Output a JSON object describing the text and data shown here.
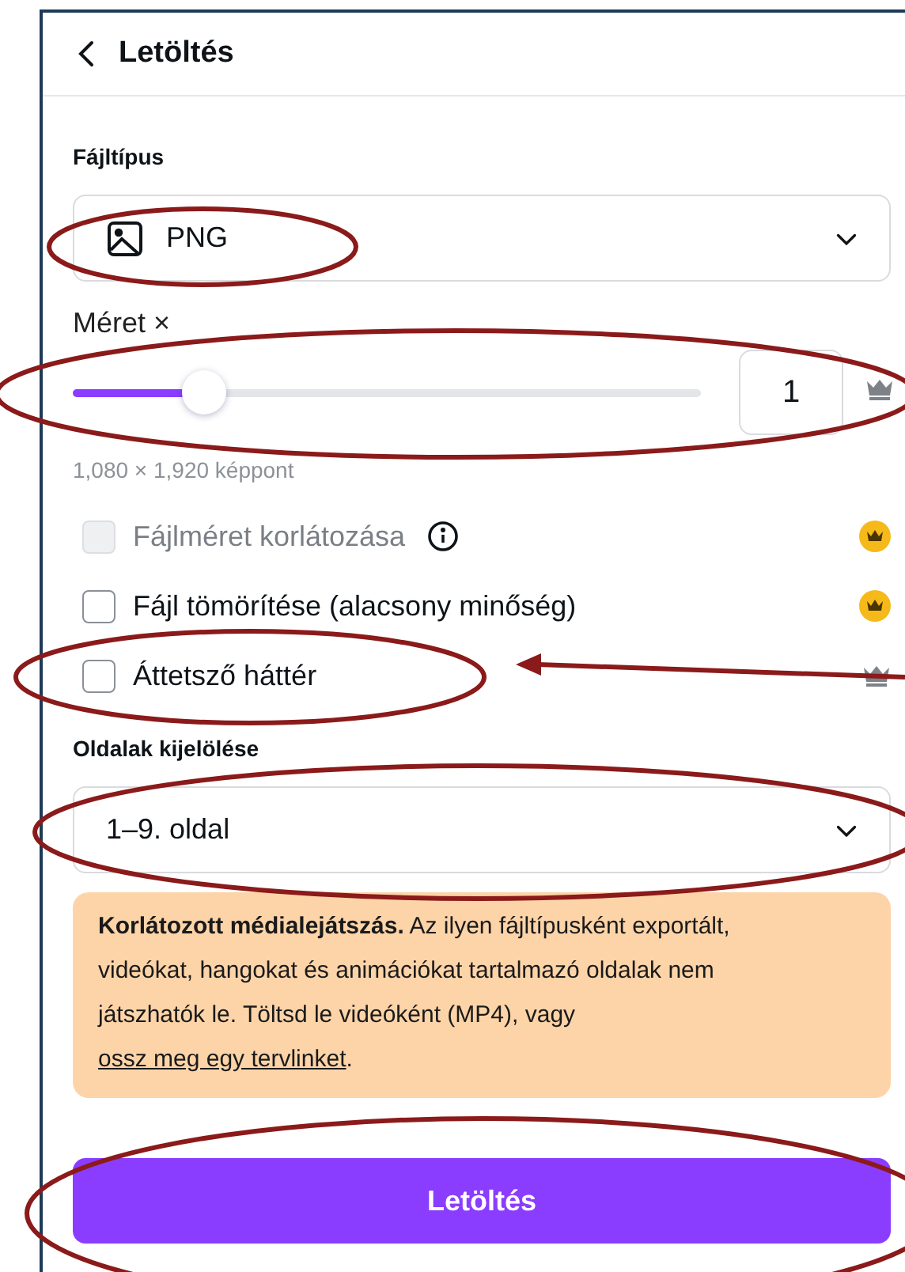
{
  "title": "Letöltés",
  "file_type": {
    "label": "Fájltípus",
    "value": "PNG"
  },
  "size": {
    "label": "Méret ×",
    "level": 0.21,
    "value": "1",
    "note": "1,080 × 1,920 képpont",
    "kind": "plain"
  },
  "options": [
    {
      "label": "Fájlméret korlátozása",
      "checked": false,
      "disabled": true,
      "info": true,
      "kind": "gold"
    },
    {
      "label": "Fájl tömörítése (alacsony minőség)",
      "checked": false,
      "disabled": false,
      "info": false,
      "kind": "gold"
    },
    {
      "label": "Áttetsző háttér",
      "checked": false,
      "disabled": false,
      "info": false,
      "kind": "plain"
    }
  ],
  "pages": {
    "label": "Oldalak kijelölése",
    "value": "1–9. oldal"
  },
  "notice": {
    "text": "**Korlátozott médialejátszás.** Az ilyen fájltípusként exportált, videókat, hangokat és animációkat tartalmazó oldalak nem játszhatók le. Töltsd le videóként (MP4), vagy",
    "link": "ossz meg egy tervlinket",
    "suffix": "."
  },
  "download_button": "Letöltés"
}
